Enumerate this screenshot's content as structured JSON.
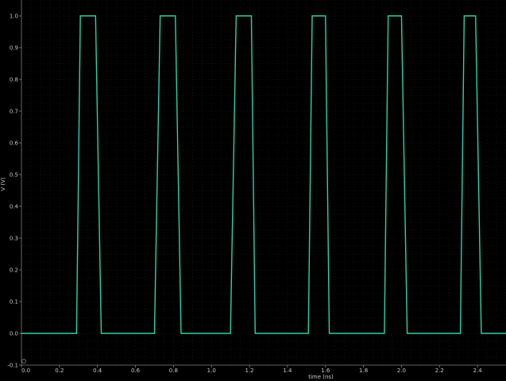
{
  "chart_data": {
    "type": "line",
    "xlabel": "time (ns)",
    "ylabel": "V (V)",
    "xlim": [
      0.0,
      2.55
    ],
    "ylim": [
      -0.1,
      1.05
    ],
    "xticks": [
      "0.0",
      "0.2",
      "0.4",
      "0.6",
      "0.8",
      "1.0",
      "1.2",
      "1.4",
      "1.6",
      "1.8",
      "2.0",
      "2.2",
      "2.4"
    ],
    "yticks": [
      "-0.1",
      "0.0",
      "0.1",
      "0.2",
      "0.3",
      "0.4",
      "0.5",
      "0.6",
      "0.7",
      "0.8",
      "0.9",
      "1.0"
    ],
    "grid": true,
    "colors": {
      "background": "#000000",
      "series": "#2fd0a8",
      "grid": "#1e1e1e",
      "axis": "#808080"
    },
    "series": [
      {
        "x": [
          0.0,
          0.29,
          0.31,
          0.39,
          0.42,
          0.7,
          0.73,
          0.81,
          0.84,
          1.1,
          1.13,
          1.21,
          1.23,
          1.51,
          1.53,
          1.6,
          1.62,
          1.91,
          1.93,
          2.0,
          2.03,
          2.31,
          2.33,
          2.39,
          2.42,
          2.55
        ],
        "y": [
          0.0,
          0.0,
          1.0,
          1.0,
          0.0,
          0.0,
          1.0,
          1.0,
          0.0,
          0.0,
          1.0,
          1.0,
          0.0,
          0.0,
          1.0,
          1.0,
          0.0,
          0.0,
          1.0,
          1.0,
          0.0,
          0.0,
          1.0,
          1.0,
          0.0,
          0.0
        ]
      }
    ]
  }
}
